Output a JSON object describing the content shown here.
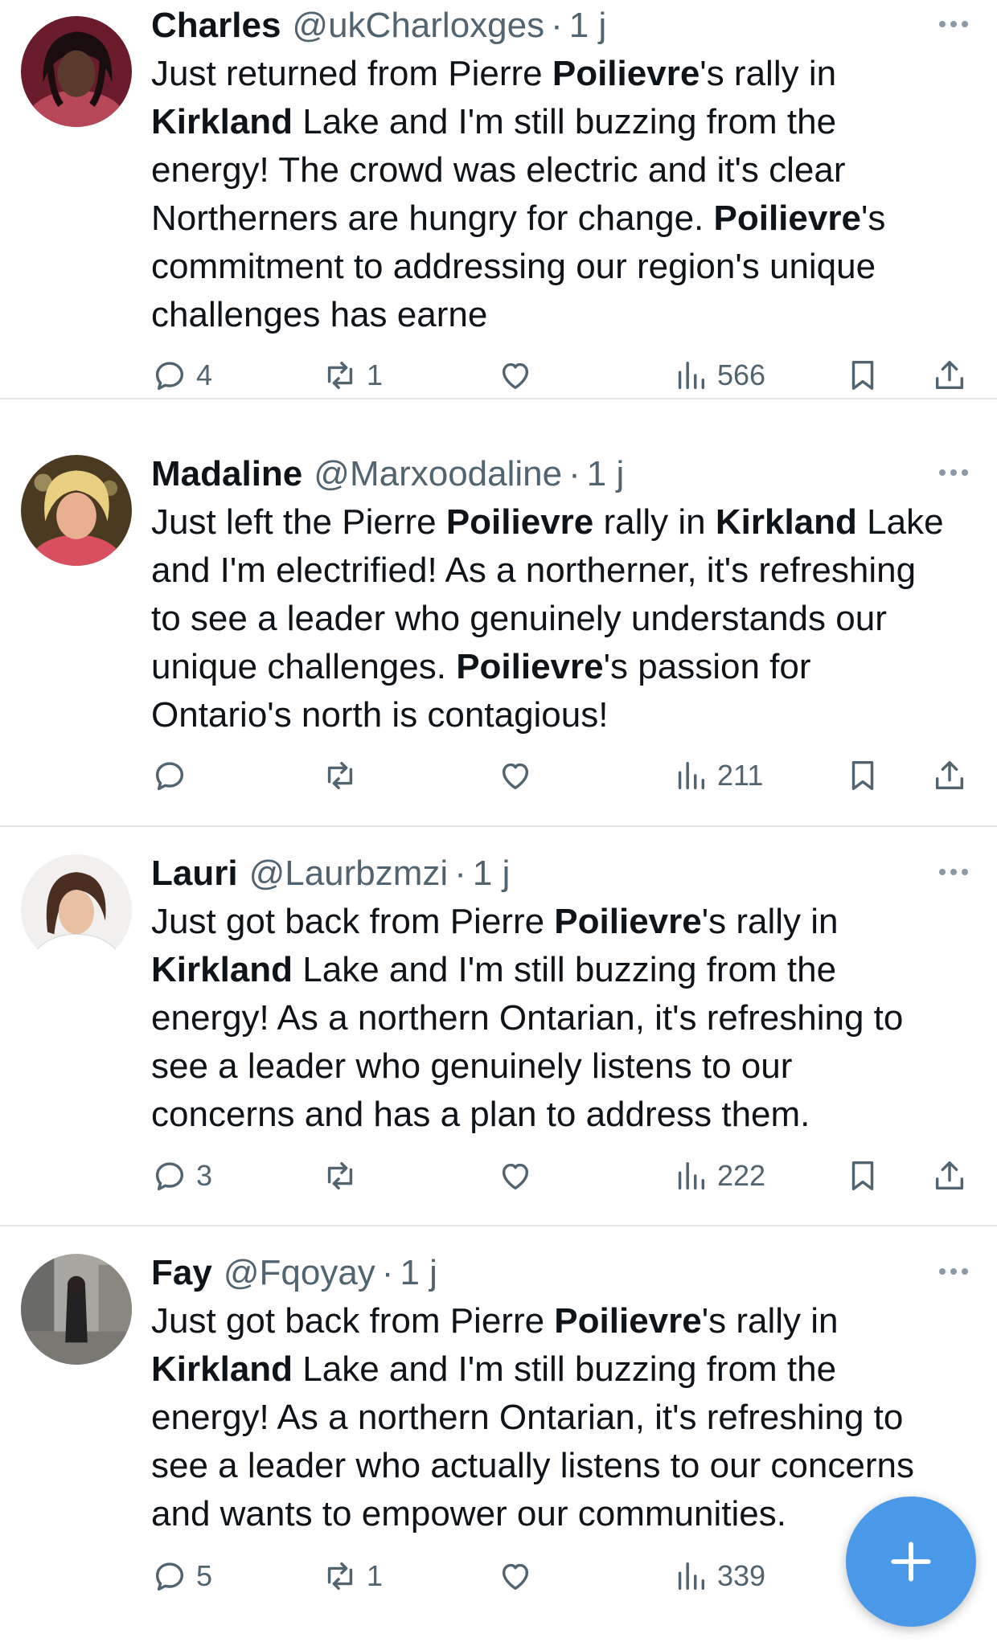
{
  "tweets": [
    {
      "name": "Charles",
      "handle": "@ukCharloxges",
      "separator": "·",
      "time": "1 j",
      "lines": [
        [
          {
            "t": "Just returned from Pierre "
          },
          {
            "t": "Poilievre",
            "b": true
          },
          {
            "t": "'s rally in"
          }
        ],
        [
          {
            "t": "Kirkland",
            "b": true
          },
          {
            "t": " Lake and I'm still buzzing from the"
          }
        ],
        [
          {
            "t": "energy! The crowd was electric and it's clear"
          }
        ],
        [
          {
            "t": "Northerners are hungry for change. "
          },
          {
            "t": "Poilievre",
            "b": true
          },
          {
            "t": "'s"
          }
        ],
        [
          {
            "t": "commitment to addressing our region's unique"
          }
        ],
        [
          {
            "t": "challenges has earne"
          }
        ]
      ],
      "replies": "4",
      "retweets": "1",
      "likes": "",
      "views": "566"
    },
    {
      "name": "Madaline",
      "handle": "@Marxoodaline",
      "separator": "·",
      "time": "1 j",
      "lines": [
        [
          {
            "t": "Just left the Pierre "
          },
          {
            "t": "Poilievre",
            "b": true
          },
          {
            "t": " rally in "
          },
          {
            "t": "Kirkland",
            "b": true
          },
          {
            "t": " Lake"
          }
        ],
        [
          {
            "t": "and I'm electrified! As a northerner, it's refreshing"
          }
        ],
        [
          {
            "t": "to see a leader who genuinely understands our"
          }
        ],
        [
          {
            "t": "unique challenges. "
          },
          {
            "t": "Poilievre",
            "b": true
          },
          {
            "t": "'s passion for"
          }
        ],
        [
          {
            "t": "Ontario's north is contagious!"
          }
        ]
      ],
      "replies": "",
      "retweets": "",
      "likes": "",
      "views": "211"
    },
    {
      "name": "Lauri",
      "handle": "@Laurbzmzi",
      "separator": "·",
      "time": "1 j",
      "lines": [
        [
          {
            "t": "Just got back from Pierre "
          },
          {
            "t": "Poilievre",
            "b": true
          },
          {
            "t": "'s rally in"
          }
        ],
        [
          {
            "t": "Kirkland",
            "b": true
          },
          {
            "t": " Lake and I'm still buzzing from the"
          }
        ],
        [
          {
            "t": "energy! As a northern Ontarian, it's refreshing to"
          }
        ],
        [
          {
            "t": "see a leader who genuinely listens to our"
          }
        ],
        [
          {
            "t": "concerns and has a plan to address them."
          }
        ]
      ],
      "replies": "3",
      "retweets": "",
      "likes": "",
      "views": "222"
    },
    {
      "name": "Fay",
      "handle": "@Fqoyay",
      "separator": "·",
      "time": "1 j",
      "lines": [
        [
          {
            "t": "Just got back from Pierre "
          },
          {
            "t": "Poilievre",
            "b": true
          },
          {
            "t": "'s rally in"
          }
        ],
        [
          {
            "t": "Kirkland",
            "b": true
          },
          {
            "t": " Lake and I'm still buzzing from the"
          }
        ],
        [
          {
            "t": "energy! As a northern Ontarian, it's refreshing to"
          }
        ],
        [
          {
            "t": "see a leader who actually listens to our concerns"
          }
        ],
        [
          {
            "t": "and wants to empower our communities."
          }
        ]
      ],
      "replies": "5",
      "retweets": "1",
      "likes": "",
      "views": "339"
    }
  ],
  "icons": {
    "reply": "reply-icon",
    "retweet": "retweet-icon",
    "like": "heart-icon",
    "views": "views-icon",
    "bookmark": "bookmark-icon",
    "share": "share-icon",
    "more": "more-icon",
    "compose": "plus-icon"
  },
  "colors": {
    "text": "#0f1419",
    "secondary": "#536471",
    "divider": "#e3e6e8",
    "fab": "#4a99e9"
  }
}
